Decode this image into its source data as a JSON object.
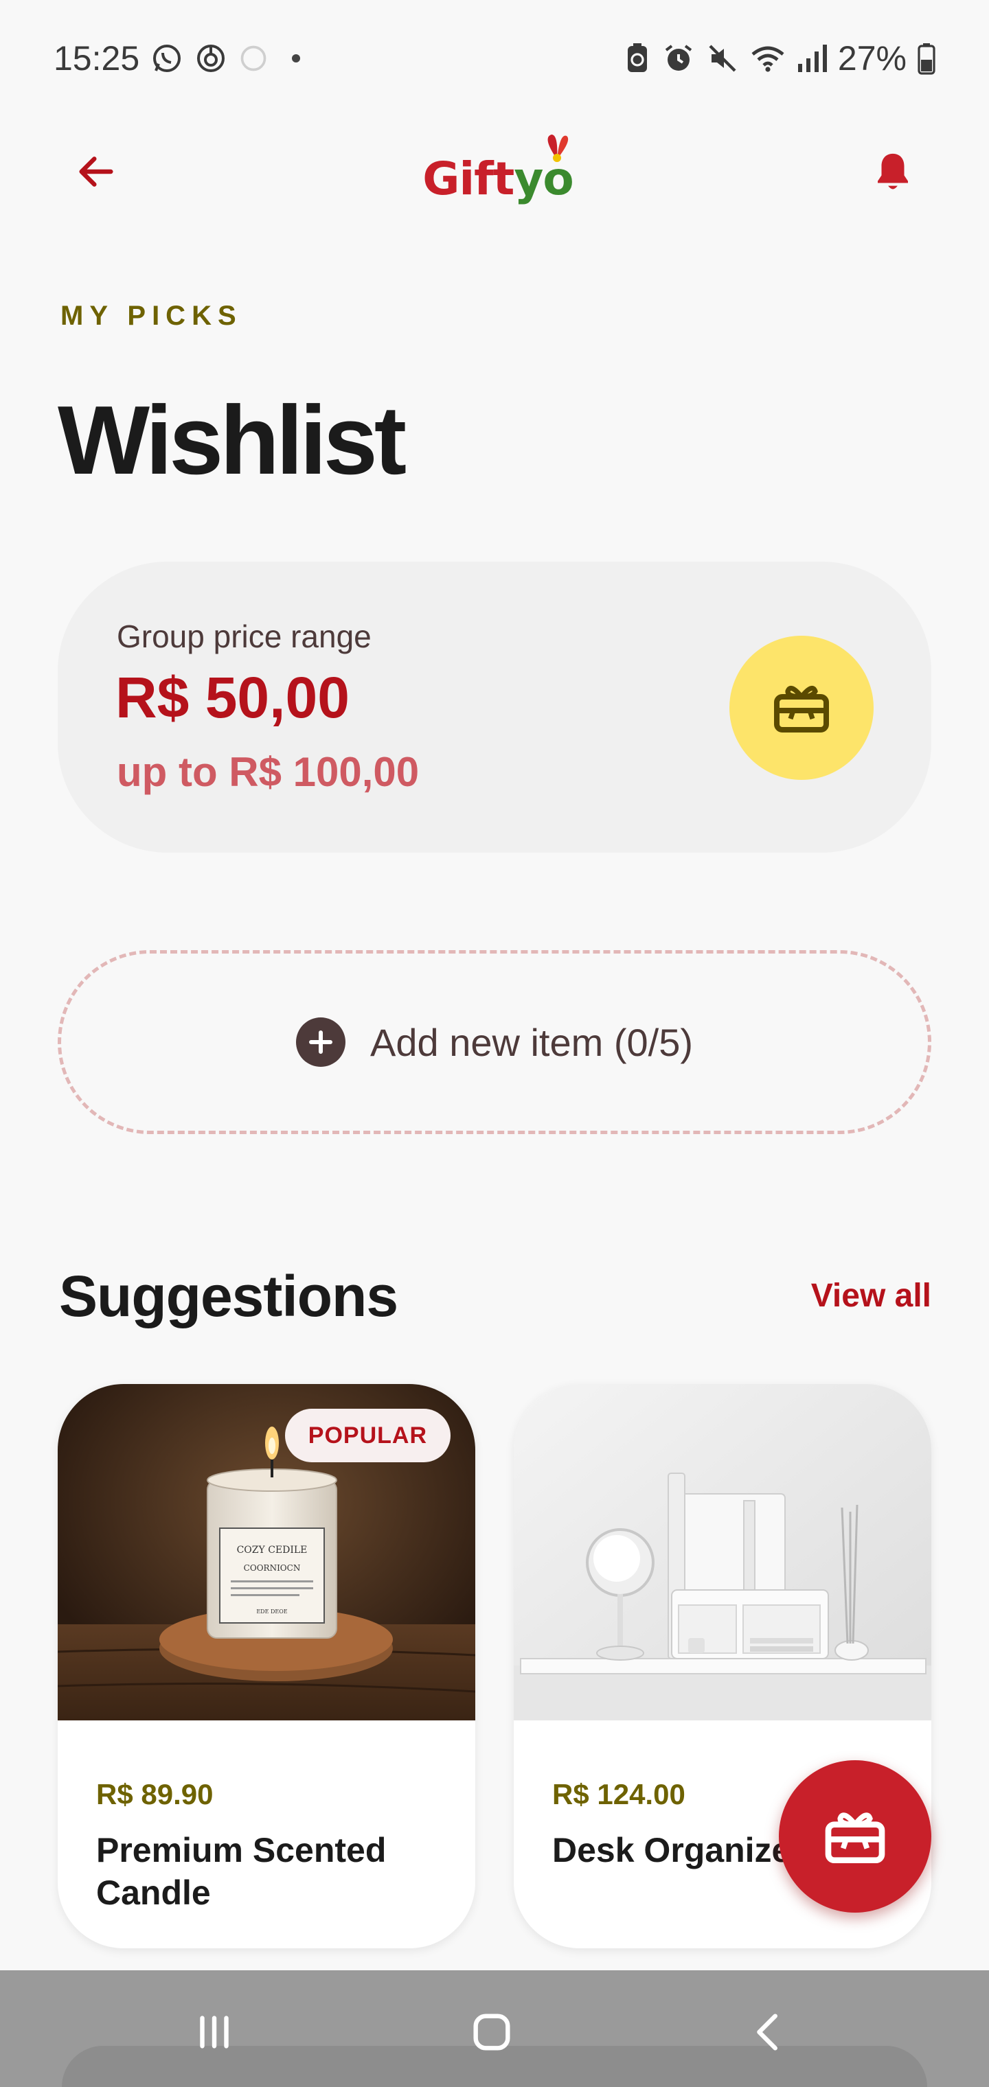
{
  "status_bar": {
    "time": "15:25",
    "battery_percent": "27%",
    "left_icons": [
      "whatsapp-icon",
      "target-icon",
      "circle-icon"
    ],
    "right_icons": [
      "battery-saver-icon",
      "alarm-icon",
      "mute-icon",
      "wifi-icon",
      "signal-icon",
      "battery-icon"
    ]
  },
  "header": {
    "logo_part1": "Gift",
    "logo_part2": "yo",
    "back_icon": "arrow-left-icon",
    "notification_icon": "bell-icon"
  },
  "page": {
    "eyebrow": "MY PICKS",
    "title": "Wishlist"
  },
  "price_card": {
    "label": "Group price range",
    "min": "R$ 50,00",
    "max": "up to R$ 100,00",
    "icon": "gift-card-icon"
  },
  "add_item": {
    "label": "Add new item (0/5)",
    "icon": "plus-circle-icon"
  },
  "suggestions": {
    "title": "Suggestions",
    "view_all": "View all",
    "items": [
      {
        "badge": "POPULAR",
        "price": "R$ 89.90",
        "name": "Premium Scented Candle",
        "jar_label_1": "COZY CEDILE",
        "jar_label_2": "COORNIOCN",
        "jar_label_3": "EDE DEOE"
      },
      {
        "price": "R$ 124.00",
        "name": "Desk Organizer"
      }
    ]
  },
  "colors": {
    "primary": "#c8202a",
    "accent_yellow": "#fde46a",
    "olive": "#6e6200",
    "background": "#f8f8f8"
  },
  "nav_bar": {
    "icons": [
      "recents-icon",
      "home-icon",
      "back-icon"
    ]
  }
}
